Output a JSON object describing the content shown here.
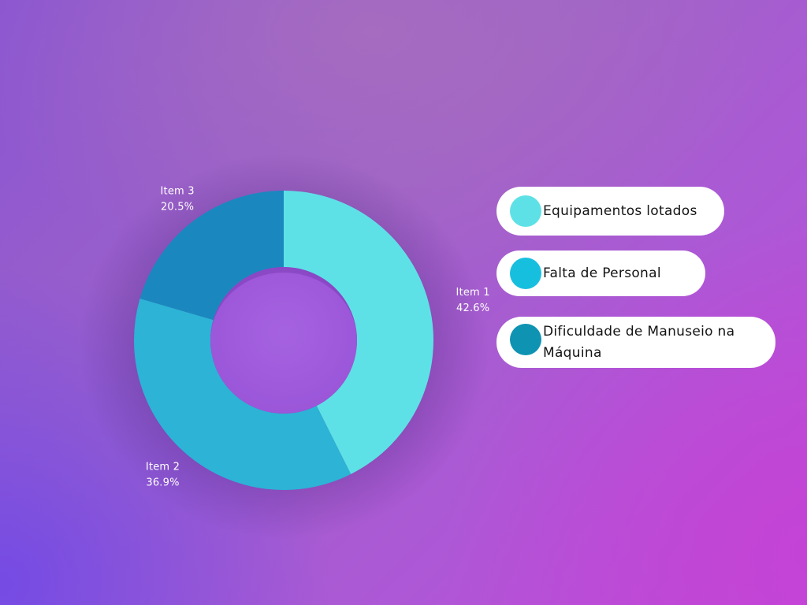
{
  "colors": {
    "slice_1": "#5ee1e6",
    "slice_2": "#2cb3d6",
    "slice_3": "#1a88bf",
    "legend_1": "#5ee1e6",
    "legend_2": "#17bfdf",
    "legend_3": "#0e93b2"
  },
  "chart_data": {
    "type": "pie",
    "variant": "donut",
    "title": "",
    "slices": [
      {
        "label": "Item 1",
        "value": 42.6,
        "display": "42.6%"
      },
      {
        "label": "Item 2",
        "value": 36.9,
        "display": "36.9%"
      },
      {
        "label": "Item 3",
        "value": 20.5,
        "display": "20.5%"
      }
    ],
    "legend_placement": "right",
    "legend": [
      {
        "text": "Equipamentos lotados"
      },
      {
        "text": "Falta de Personal"
      },
      {
        "text": "Dificuldade de Manuseio na Máquina"
      }
    ]
  }
}
